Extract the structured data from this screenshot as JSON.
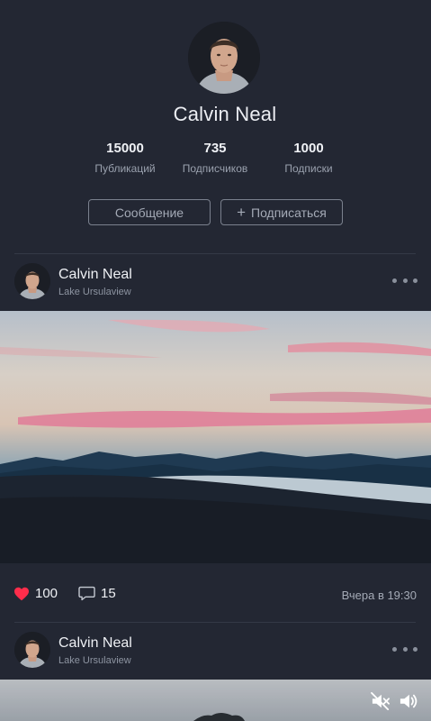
{
  "profile": {
    "name": "Calvin Neal",
    "stats": [
      {
        "value": "15000",
        "label": "Публикаций"
      },
      {
        "value": "735",
        "label": "Подписчиков"
      },
      {
        "value": "1000",
        "label": "Подписки"
      }
    ],
    "message_button": "Сообщение",
    "subscribe_button": "Подписаться"
  },
  "posts": [
    {
      "author": "Calvin Neal",
      "location": "Lake Ursulaview",
      "likes": "100",
      "comments": "15",
      "time": "Вчера в 19:30"
    },
    {
      "author": "Calvin Neal",
      "location": "Lake Ursulaview"
    }
  ],
  "colors": {
    "background": "#232733",
    "like": "#ff2d4b",
    "text_muted": "#9aa1ae"
  },
  "icons": [
    "heart-icon",
    "comment-icon",
    "more-icon",
    "mute-icon",
    "volume-icon"
  ]
}
